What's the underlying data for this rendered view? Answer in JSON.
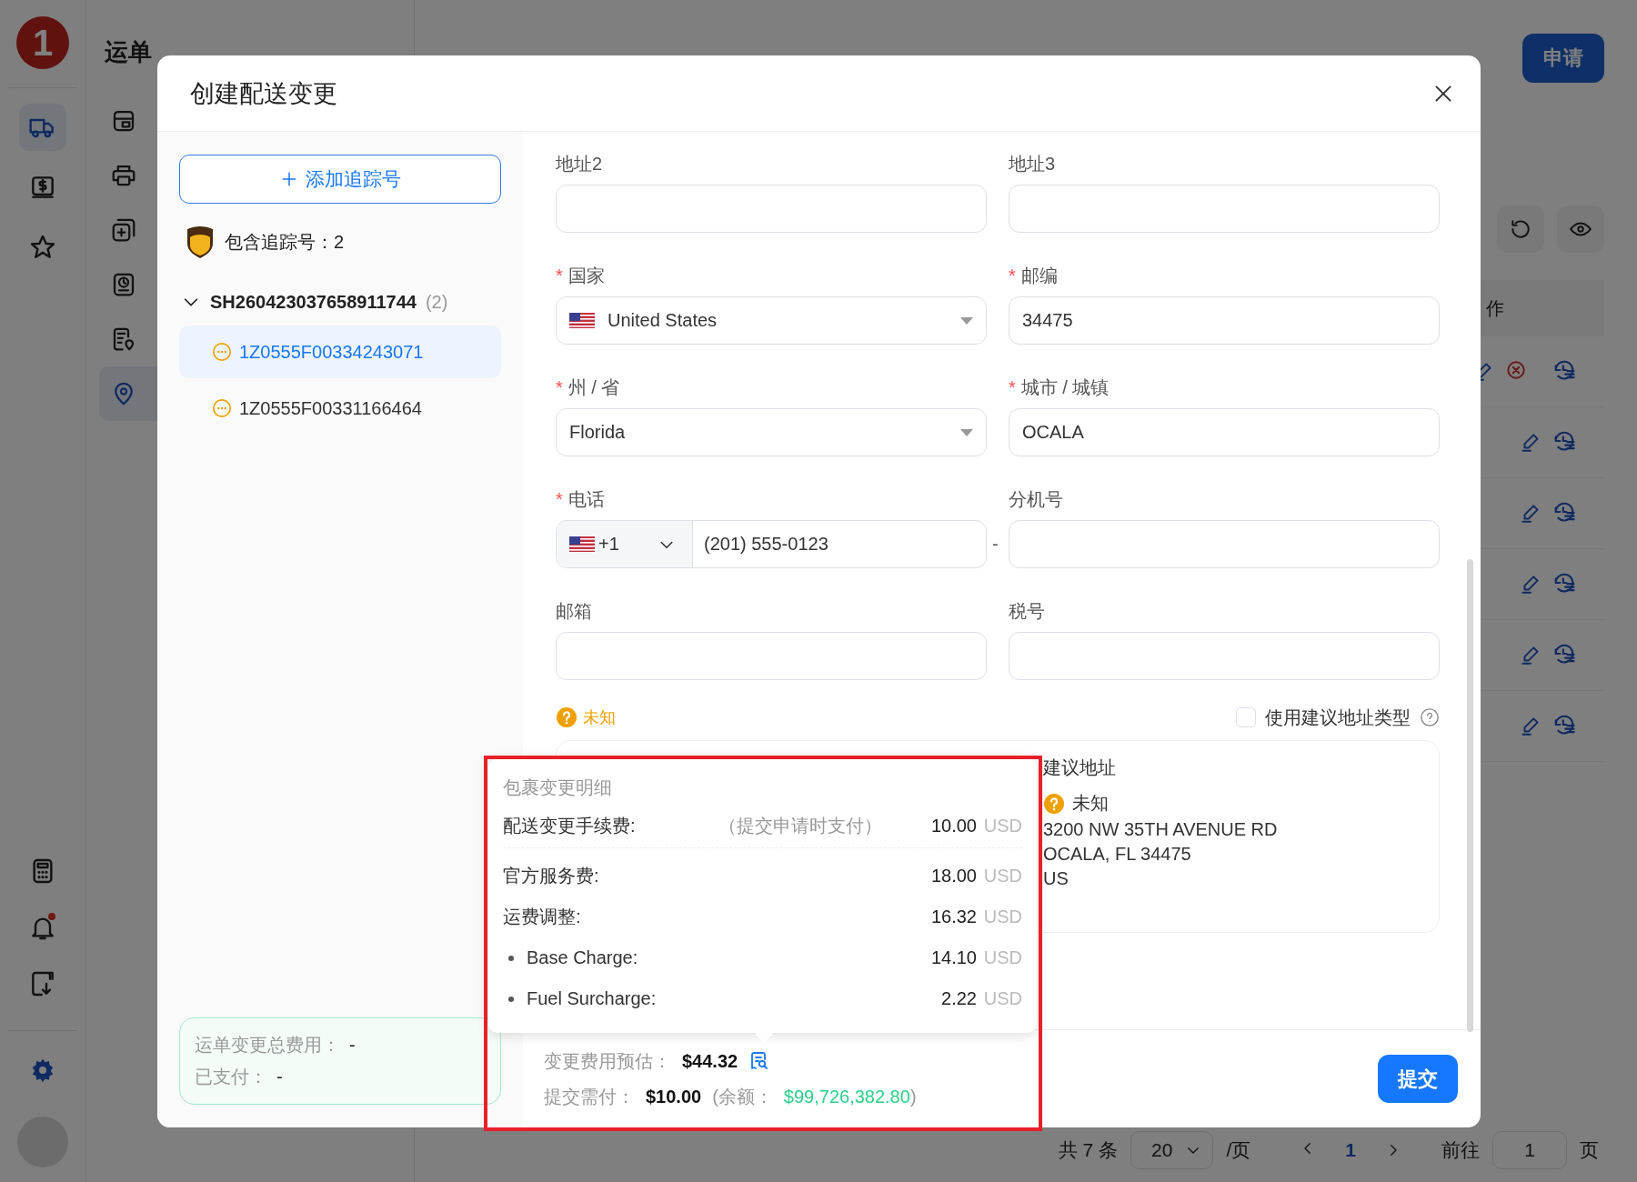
{
  "rail": {
    "logo": "1",
    "items": [
      {
        "selected": true
      },
      {
        "selected": false
      },
      {
        "selected": false
      }
    ],
    "bell_unread": true
  },
  "side_panel": {
    "title": "运单",
    "menu": [
      {
        "selected": false
      },
      {
        "selected": false
      },
      {
        "selected": false
      },
      {
        "selected": false
      },
      {
        "selected": false
      },
      {
        "selected": true
      }
    ]
  },
  "list_page": {
    "apply_button": "申请",
    "column_header": "作",
    "rows": [
      {
        "cancellable": true
      },
      {
        "cancellable": false
      },
      {
        "cancellable": false
      },
      {
        "cancellable": false
      },
      {
        "cancellable": false
      },
      {
        "cancellable": false
      }
    ],
    "pagination": {
      "total": "共 7 条",
      "page_size": "20",
      "per_page": "/页",
      "current_page": "1",
      "goto_label": "前往",
      "goto_value": "1",
      "page_suffix": "页"
    }
  },
  "dialog": {
    "title": "创建配送变更",
    "add_tracking_button": "添加追踪号",
    "carrier_summary": "包含追踪号：2",
    "tree": [
      {
        "label": "SH260423037658911744",
        "count": "(2)",
        "expanded": true,
        "children": [
          {
            "label": "1Z0555F00334243071",
            "selected": true
          },
          {
            "label": "1Z0555F00331166464",
            "selected": false
          }
        ]
      }
    ],
    "totals": {
      "total_label": "运单变更总费用：",
      "total_value": "-",
      "paid_label": "已支付：",
      "paid_value": "-"
    },
    "fields": [
      {
        "kind": "text",
        "label": "地址2"
      },
      {
        "kind": "text",
        "label": "地址3"
      },
      {
        "kind": "country",
        "label": "国家",
        "required_mark": "*",
        "value": "United States"
      },
      {
        "kind": "text",
        "label": "邮编",
        "required_mark": "*",
        "value": "34475"
      },
      {
        "kind": "select",
        "label": "州 / 省",
        "required_mark": "*",
        "value": "Florida"
      },
      {
        "kind": "text",
        "label": "城市 / 城镇",
        "required_mark": "*",
        "value": "OCALA"
      },
      {
        "kind": "phone",
        "label": "电话",
        "required_mark": "*",
        "code": "+1",
        "value": "(201) 555-0123"
      },
      {
        "kind": "text",
        "label": "分机号",
        "prefix": "-"
      },
      {
        "kind": "text",
        "label": "邮箱"
      },
      {
        "kind": "text",
        "label": "税号"
      }
    ],
    "address_type": "未知",
    "use_suggested_type": {
      "label": "使用建议地址类型",
      "checked": false
    },
    "suggested_address": {
      "title": "建议地址",
      "type": "未知",
      "lines": [
        "3200 NW 35TH AVENUE RD",
        "OCALA, FL 34475",
        "US"
      ]
    },
    "fee_popover": {
      "title": "包裹变更明细",
      "rows": [
        {
          "kind": "main",
          "label": "配送变更手续费:",
          "note": "（提交申请时支付）",
          "amount": "10.00",
          "currency": "USD",
          "divider": true
        },
        {
          "kind": "main",
          "label": "官方服务费:",
          "amount": "18.00",
          "currency": "USD",
          "divider": false
        },
        {
          "kind": "main",
          "label": "运费调整:",
          "amount": "16.32",
          "currency": "USD",
          "divider": false
        },
        {
          "kind": "bullet",
          "label": "Base Charge:",
          "amount": "14.10",
          "currency": "USD",
          "divider": false
        },
        {
          "kind": "bullet",
          "label": "Fuel Surcharge:",
          "amount": "2.22",
          "currency": "USD",
          "divider": false
        }
      ]
    },
    "footer": {
      "estimate_label": "变更费用预估：",
      "estimate_value": "$44.32",
      "due_label": "提交需付：",
      "due_value": "$10.00",
      "balance_open": "(余额：",
      "balance_value": "$99,726,382.80",
      "balance_close": ")",
      "submit_button": "提交"
    }
  }
}
